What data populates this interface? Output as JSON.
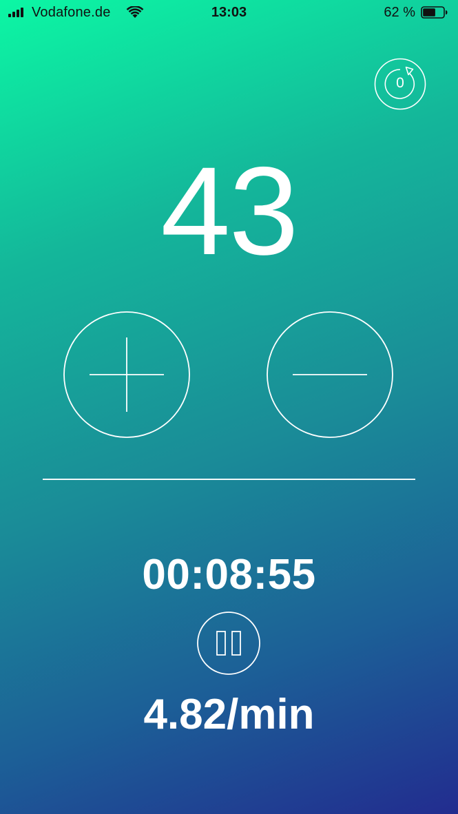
{
  "status_bar": {
    "carrier": "Vodafone.de",
    "time": "13:03",
    "battery_percent": "62 %",
    "battery_level": 0.62,
    "signal_bars": 4
  },
  "reset": {
    "count": "0",
    "icon": "reset-counter-icon"
  },
  "counter": {
    "value": "43"
  },
  "controls": {
    "increment_icon": "plus-icon",
    "decrement_icon": "minus-icon",
    "pause_icon": "pause-icon"
  },
  "timer": {
    "elapsed": "00:08:55"
  },
  "stats": {
    "rate": "4.82/min"
  },
  "colors": {
    "gradient_start": "#0cf7a4",
    "gradient_end": "#222c8f",
    "foreground": "#ffffff"
  }
}
